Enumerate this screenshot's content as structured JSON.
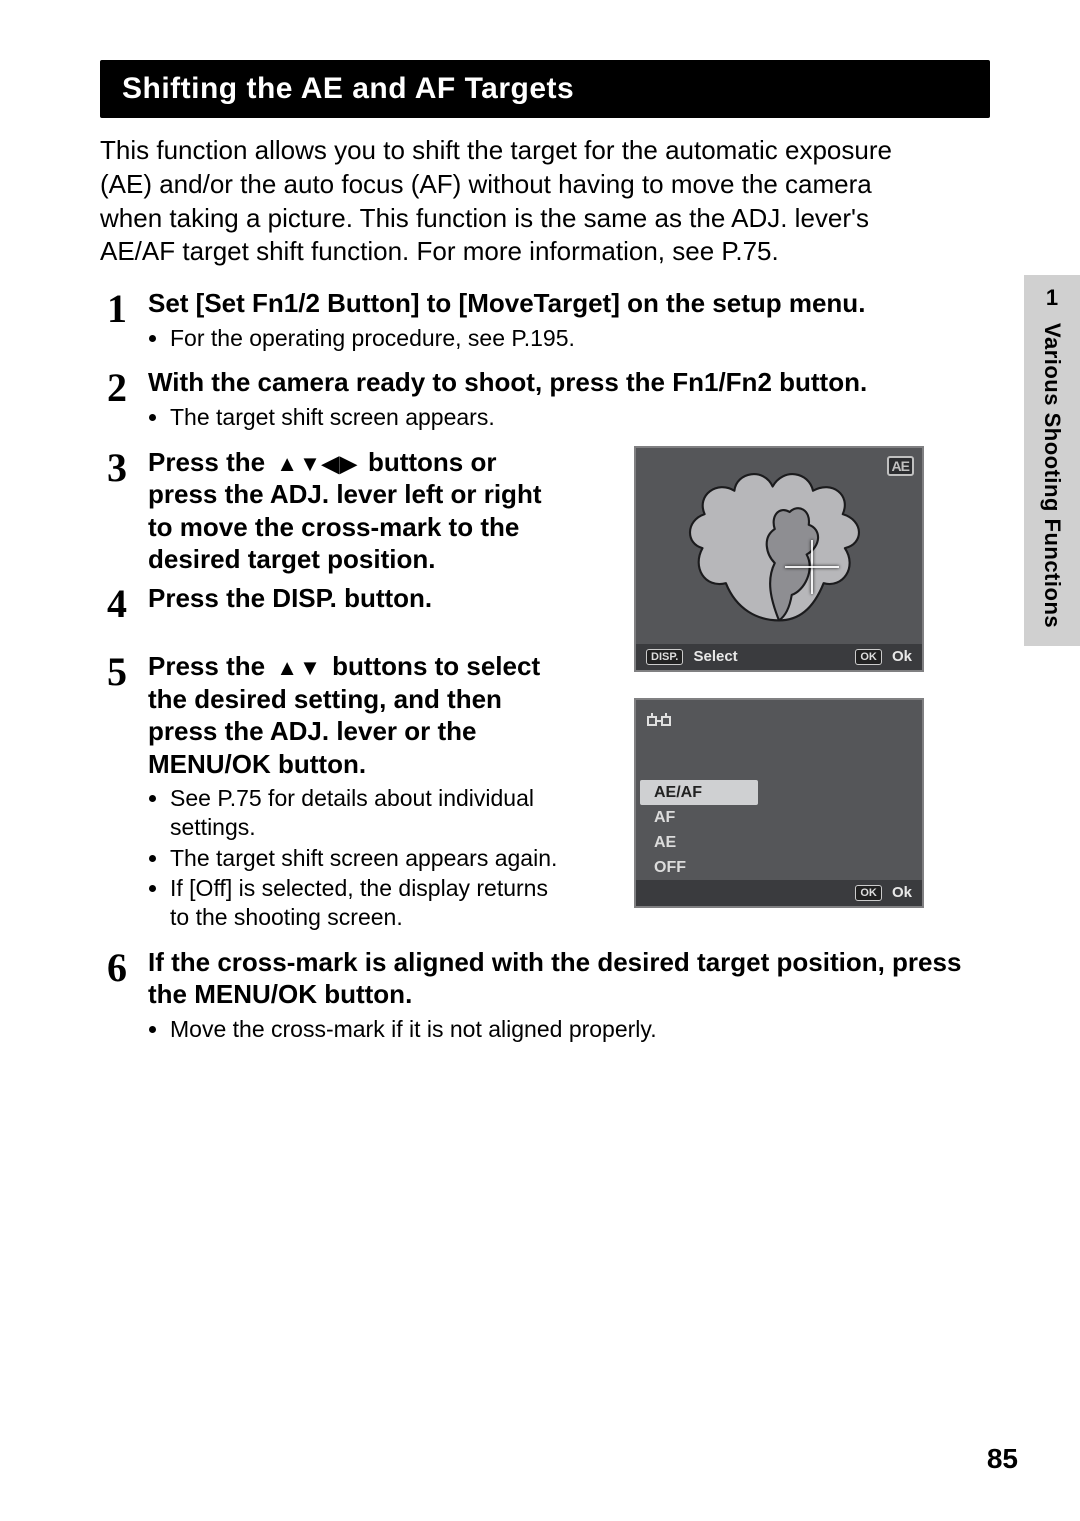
{
  "section_title": "Shifting the AE and AF Targets",
  "intro": "This function allows you to shift the target for the automatic exposure (AE) and/or the auto focus (AF) without having to move the camera when taking a picture. This function is the same as the ADJ. lever's AE/AF target shift function. For more information, see P.75.",
  "side_tab": {
    "num": "1",
    "label": "Various Shooting Functions"
  },
  "page_number": "85",
  "steps": [
    {
      "num": "1",
      "title": "Set [Set Fn1/2 Button] to [MoveTarget] on the setup menu.",
      "notes": [
        "For the operating procedure, see P.195."
      ]
    },
    {
      "num": "2",
      "title": "With the camera ready to shoot, press the Fn1/Fn2 button.",
      "notes": [
        "The target shift screen appears."
      ]
    },
    {
      "num": "3",
      "title_a": "Press the ",
      "title_b": " buttons or press the ADJ. lever left or right to move the cross-mark to the desired target position.",
      "arrows": "udlr",
      "notes": []
    },
    {
      "num": "4",
      "title": "Press the DISP. button.",
      "notes": []
    },
    {
      "num": "5",
      "title_a": "Press the ",
      "title_b": " buttons to select the desired setting, and then press the ADJ. lever or the MENU/OK button.",
      "arrows": "ud",
      "notes": [
        "See P.75 for details about individual settings.",
        "The target shift screen appears again.",
        "If [Off] is selected, the display returns to the shooting screen."
      ]
    },
    {
      "num": "6",
      "title": "If the cross-mark is aligned with the desired target position, press the MENU/OK button.",
      "notes": [
        "Move the cross-mark if it is not aligned properly."
      ]
    }
  ],
  "screen1": {
    "badge": "AE",
    "footer_left_key": "DISP.",
    "footer_left_label": "Select",
    "footer_right_key": "OK",
    "footer_right_label": "Ok"
  },
  "screen2": {
    "options": [
      "AE/AF",
      "AF",
      "AE",
      "OFF"
    ],
    "selected_index": 0,
    "footer_right_key": "OK",
    "footer_right_label": "Ok"
  }
}
